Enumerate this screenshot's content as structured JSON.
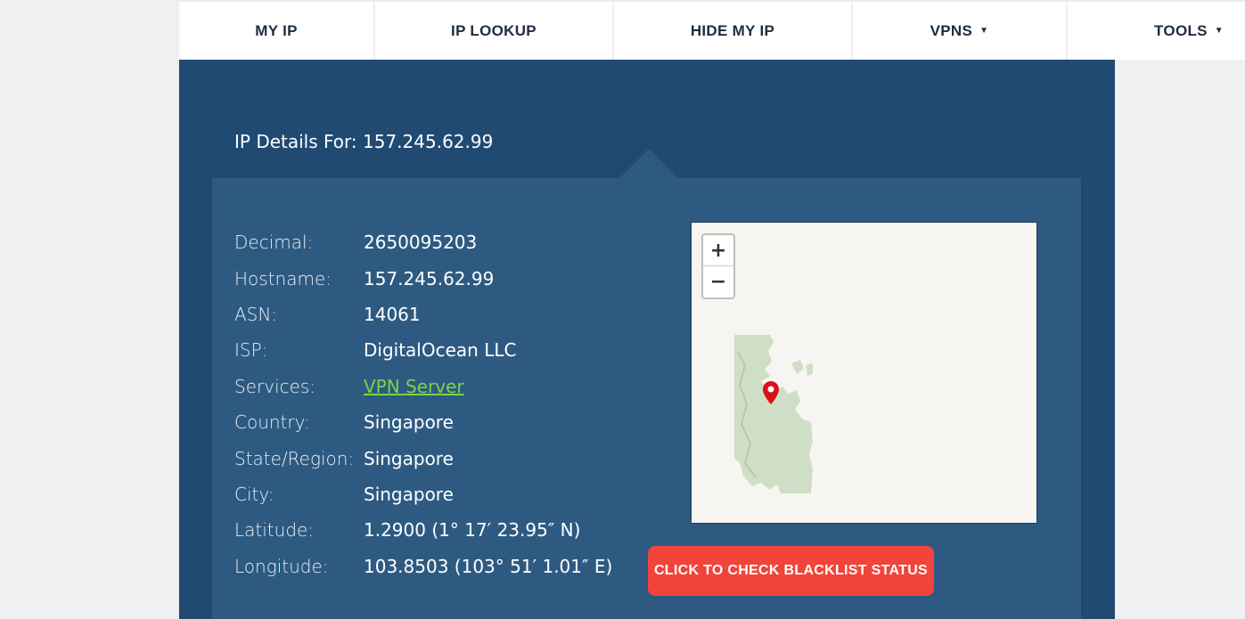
{
  "nav": {
    "items": [
      {
        "label": "MY IP",
        "caret": ""
      },
      {
        "label": "IP LOOKUP",
        "caret": ""
      },
      {
        "label": "HIDE MY IP",
        "caret": ""
      },
      {
        "label": "VPNS",
        "caret": "▼"
      },
      {
        "label": "TOOLS",
        "caret": "▼"
      }
    ]
  },
  "panel": {
    "heading": "IP Details For: 157.245.62.99",
    "details": [
      {
        "label": "Decimal:",
        "value": "2650095203"
      },
      {
        "label": "Hostname:",
        "value": "157.245.62.99"
      },
      {
        "label": "ASN:",
        "value": "14061"
      },
      {
        "label": "ISP:",
        "value": "DigitalOcean LLC"
      },
      {
        "label": "Services:",
        "value": "VPN Server"
      },
      {
        "label": "Country:",
        "value": "Singapore"
      },
      {
        "label": "State/Region:",
        "value": "Singapore"
      },
      {
        "label": "City:",
        "value": "Singapore"
      },
      {
        "label": "Latitude:",
        "value": "1.2900 (1° 17′ 23.95″ N)"
      },
      {
        "label": "Longitude:",
        "value": "103.8503 (103° 51′ 1.01″ E)"
      }
    ],
    "map": {
      "zoom_in": "+",
      "zoom_out": "−",
      "marker_icon": "map-pin-icon"
    },
    "blacklist_button": "CLICK TO CHECK BLACKLIST STATUS"
  },
  "colors": {
    "panel_bg": "#214a73",
    "card_bg": "#2e5a82",
    "link": "#7cd446",
    "button": "#f1443a"
  }
}
